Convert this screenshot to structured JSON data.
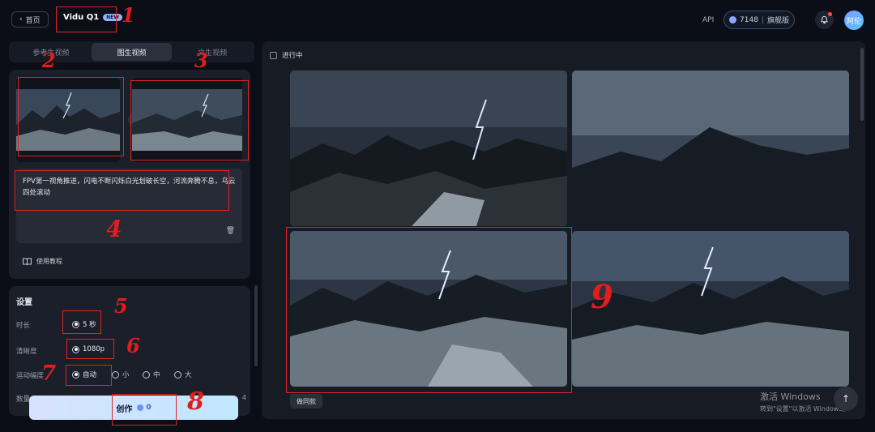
{
  "header": {
    "back_label": "首页",
    "model_name": "Vidu Q1",
    "model_badge": "NEW",
    "api_label": "API",
    "credits_value": "7148",
    "plan_label": "旗舰版",
    "avatar_text": "阿伦"
  },
  "tabs": [
    {
      "label": "参考生视频",
      "active": false
    },
    {
      "label": "图生视频",
      "active": true
    },
    {
      "label": "文生视频",
      "active": false
    }
  ],
  "upload": {
    "prompt_text": "FPV第一视角推进，闪电不断闪烁白光划破长空，河流奔腾不息，乌云四处滚动",
    "tutorial_label": "使用教程"
  },
  "settings": {
    "title": "设置",
    "duration_label": "时长",
    "duration_value": "5 秒",
    "resolution_label": "清晰度",
    "resolution_value": "1080p",
    "motion_label": "运动幅度",
    "motion_options": [
      "自动",
      "小",
      "中",
      "大"
    ],
    "motion_selected": "自动",
    "count_label": "数量",
    "count_value": "4"
  },
  "create_button": {
    "label": "创作",
    "cost": "0"
  },
  "results": {
    "status_label": "进行中",
    "same_style_label": "做同款"
  },
  "watermark": {
    "line1": "激活 Windows",
    "line2": "转到\"设置\"以激活 Windows。"
  },
  "annotations": [
    "1",
    "2",
    "3",
    "4",
    "5",
    "6",
    "7",
    "8",
    "9"
  ],
  "colors": {
    "accent": "#8aa8ff",
    "annotation": "#e02424",
    "panel": "#1b1f29"
  }
}
